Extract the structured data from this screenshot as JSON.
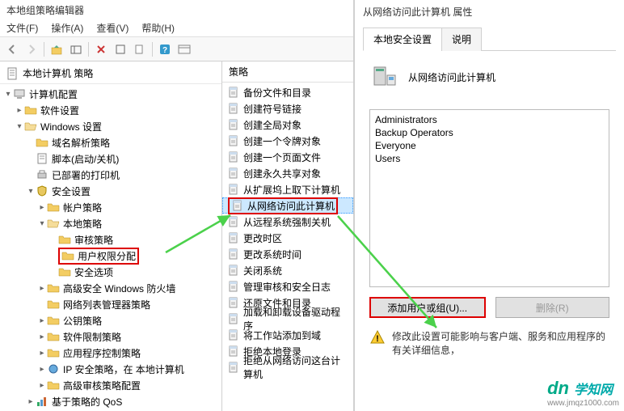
{
  "window": {
    "title": "本地组策略编辑器",
    "menu": {
      "file": "文件(F)",
      "action": "操作(A)",
      "view": "查看(V)",
      "help": "帮助(H)"
    }
  },
  "tree": {
    "root_label": "本地计算机 策略",
    "items": [
      {
        "lvl": 0,
        "exp": "▾",
        "icon": "computer",
        "label": "计算机配置"
      },
      {
        "lvl": 1,
        "exp": "▸",
        "icon": "folder",
        "label": "软件设置"
      },
      {
        "lvl": 1,
        "exp": "▾",
        "icon": "folder-open",
        "label": "Windows 设置"
      },
      {
        "lvl": 2,
        "exp": "",
        "icon": "folder",
        "label": "域名解析策略"
      },
      {
        "lvl": 2,
        "exp": "",
        "icon": "script",
        "label": "脚本(启动/关机)"
      },
      {
        "lvl": 2,
        "exp": "",
        "icon": "printer",
        "label": "已部署的打印机"
      },
      {
        "lvl": 2,
        "exp": "▾",
        "icon": "security",
        "label": "安全设置"
      },
      {
        "lvl": 3,
        "exp": "▸",
        "icon": "folder",
        "label": "帐户策略"
      },
      {
        "lvl": 3,
        "exp": "▾",
        "icon": "folder-open",
        "label": "本地策略"
      },
      {
        "lvl": 4,
        "exp": "",
        "icon": "folder",
        "label": "审核策略"
      },
      {
        "lvl": 4,
        "exp": "",
        "icon": "folder",
        "label": "用户权限分配",
        "hl": true
      },
      {
        "lvl": 4,
        "exp": "",
        "icon": "folder",
        "label": "安全选项"
      },
      {
        "lvl": 3,
        "exp": "▸",
        "icon": "folder",
        "label": "高级安全 Windows 防火墙"
      },
      {
        "lvl": 3,
        "exp": "",
        "icon": "folder",
        "label": "网络列表管理器策略"
      },
      {
        "lvl": 3,
        "exp": "▸",
        "icon": "folder",
        "label": "公钥策略"
      },
      {
        "lvl": 3,
        "exp": "▸",
        "icon": "folder",
        "label": "软件限制策略"
      },
      {
        "lvl": 3,
        "exp": "▸",
        "icon": "folder",
        "label": "应用程序控制策略"
      },
      {
        "lvl": 3,
        "exp": "▸",
        "icon": "ipsec",
        "label": "IP 安全策略，在 本地计算机"
      },
      {
        "lvl": 3,
        "exp": "▸",
        "icon": "folder",
        "label": "高级审核策略配置"
      },
      {
        "lvl": 2,
        "exp": "▸",
        "icon": "qos",
        "label": "基于策略的 QoS"
      }
    ]
  },
  "list": {
    "header": "策略",
    "items": [
      {
        "label": "备份文件和目录"
      },
      {
        "label": "创建符号链接"
      },
      {
        "label": "创建全局对象"
      },
      {
        "label": "创建一个令牌对象"
      },
      {
        "label": "创建一个页面文件"
      },
      {
        "label": "创建永久共享对象"
      },
      {
        "label": "从扩展坞上取下计算机"
      },
      {
        "label": "从网络访问此计算机",
        "sel": true,
        "hl": true
      },
      {
        "label": "从远程系统强制关机"
      },
      {
        "label": "更改时区"
      },
      {
        "label": "更改系统时间"
      },
      {
        "label": "关闭系统"
      },
      {
        "label": "管理审核和安全日志"
      },
      {
        "label": "还原文件和目录"
      },
      {
        "label": "加载和卸载设备驱动程序"
      },
      {
        "label": "将工作站添加到域"
      },
      {
        "label": "拒绝本地登录"
      },
      {
        "label": "拒绝从网络访问这台计算机"
      }
    ]
  },
  "prop": {
    "title": "从网络访问此计算机 属性",
    "tabs": {
      "local": "本地安全设置",
      "explain": "说明"
    },
    "header_label": "从网络访问此计算机",
    "users": [
      "Administrators",
      "Backup Operators",
      "Everyone",
      "Users"
    ],
    "buttons": {
      "add": "添加用户或组(U)...",
      "remove": "删除(R)"
    },
    "warning": {
      "line1": "修改此设置可能影响与客户端、服务和应用程序的",
      "line2": "有关详细信息，"
    }
  },
  "logo": {
    "mark": "dn",
    "cn": "学知网",
    "url": "www.jmqz1000.com"
  }
}
